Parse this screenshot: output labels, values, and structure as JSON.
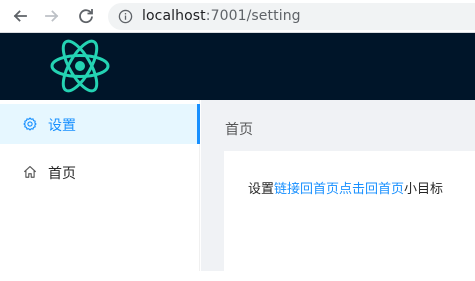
{
  "browser": {
    "url_host": "localhost",
    "url_path": ":7001/setting"
  },
  "header": {
    "logo_icon": "react-logo-icon",
    "logo_color": "#24d3b3",
    "background": "#001529"
  },
  "sidebar": {
    "items": [
      {
        "label": "设置",
        "icon": "gear-icon",
        "active": true
      },
      {
        "label": "首页",
        "icon": "home-icon",
        "active": false
      }
    ],
    "active_color": "#1890ff"
  },
  "main": {
    "breadcrumb": "首页",
    "message": {
      "prefix": "设置",
      "link1": "链接回首页",
      "link2": "点击回首页",
      "suffix": "小目标"
    }
  }
}
